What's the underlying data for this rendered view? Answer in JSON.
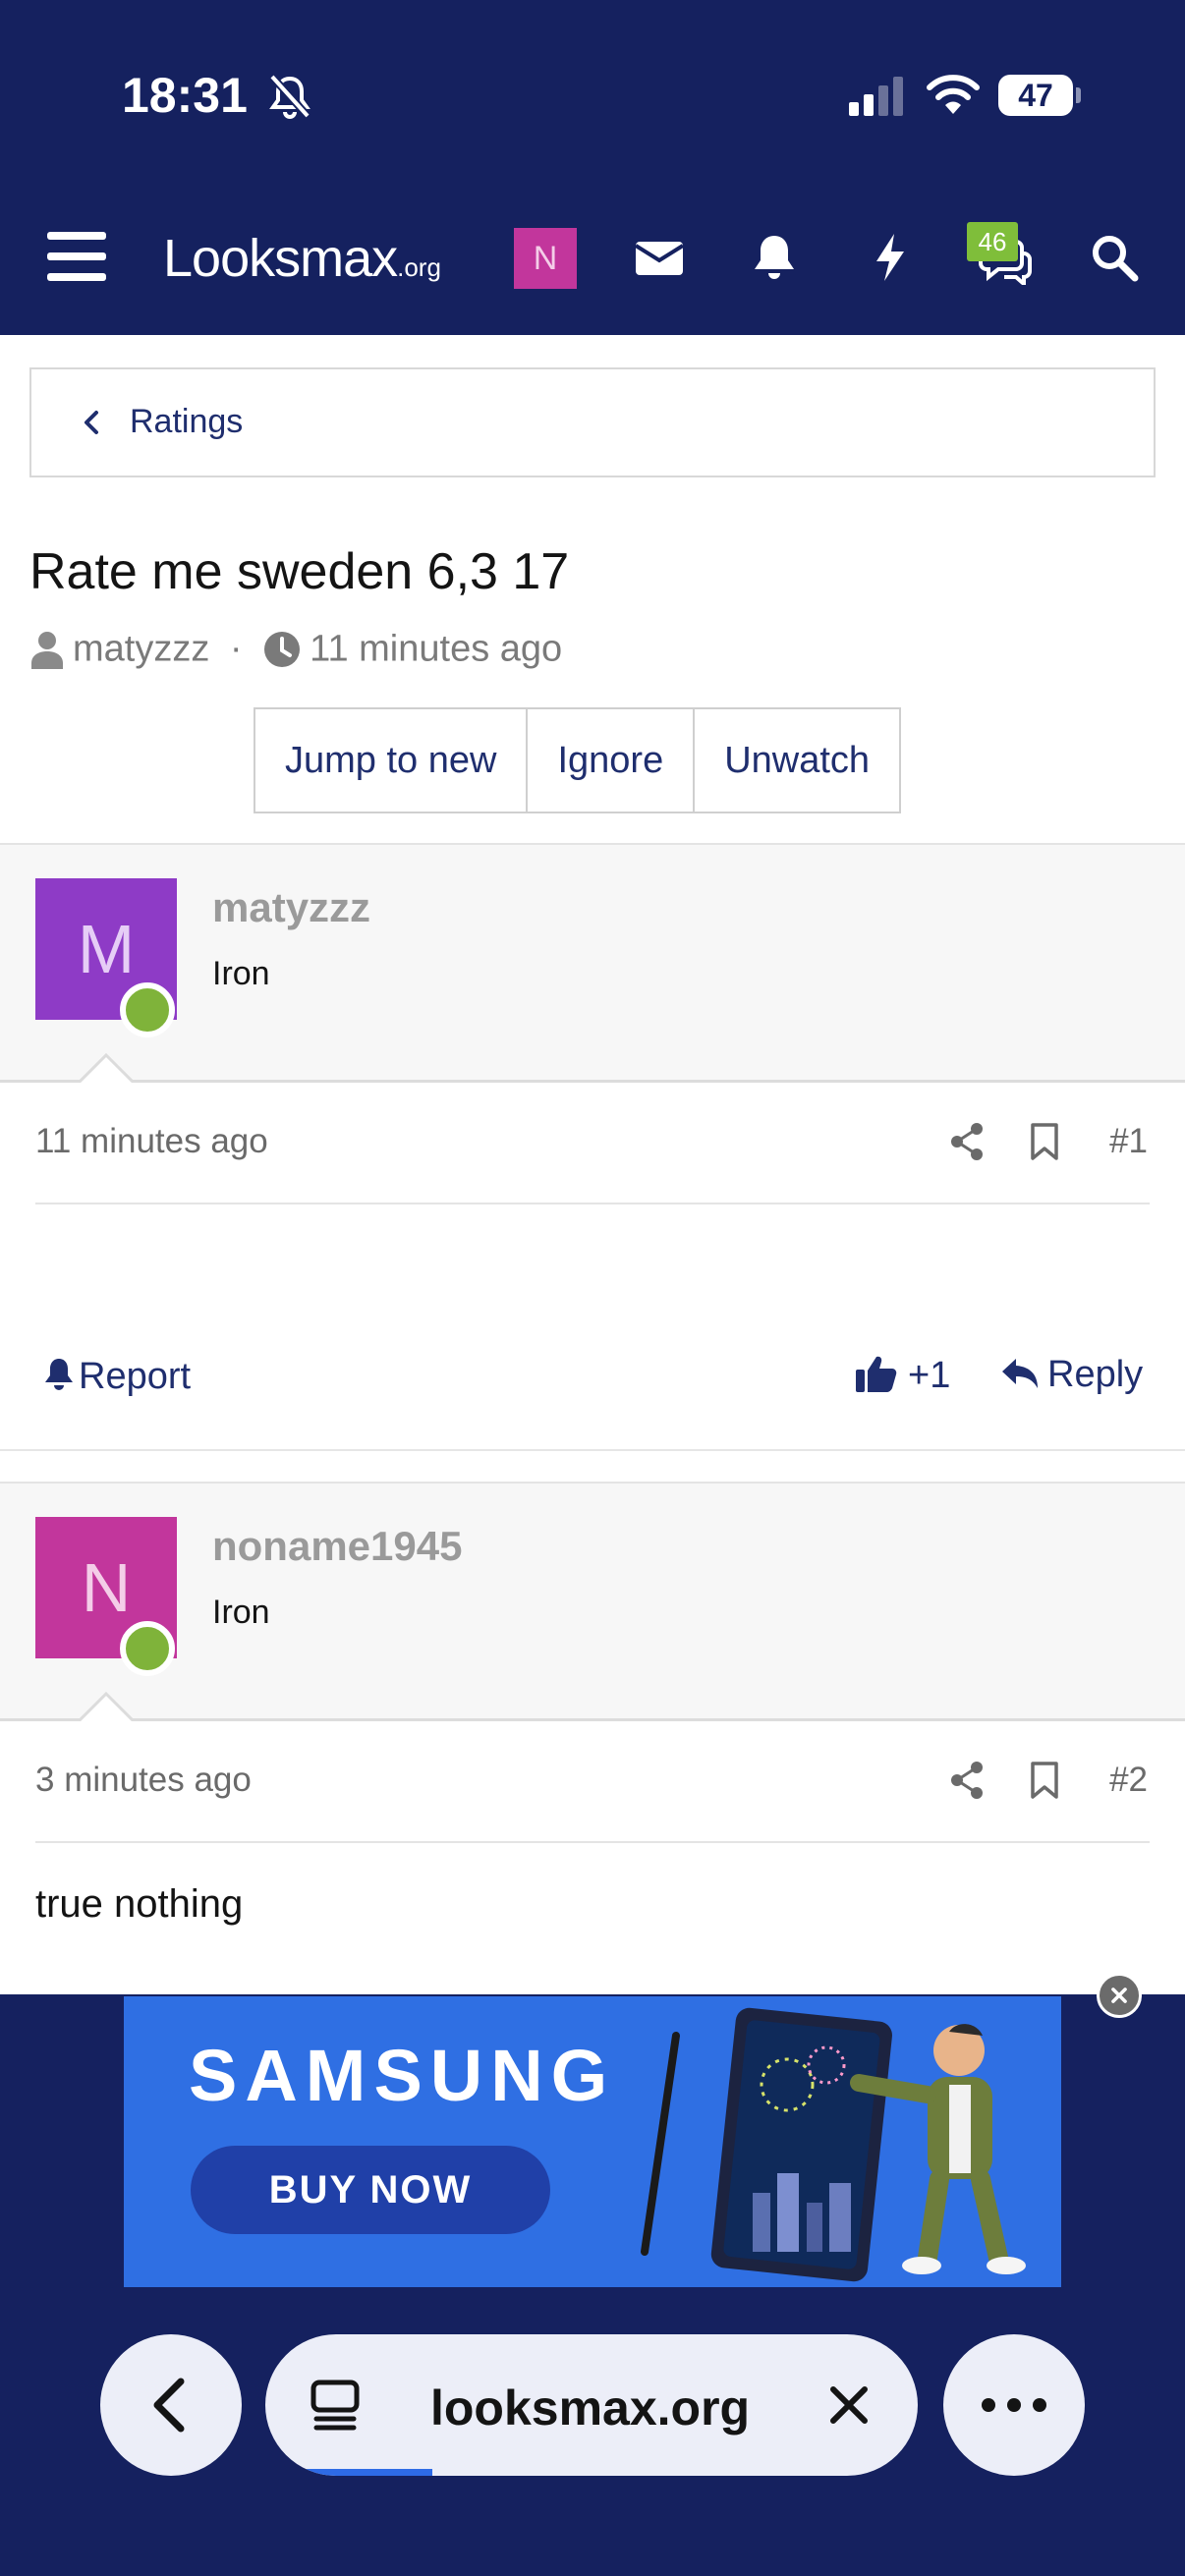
{
  "status_bar": {
    "time": "18:31",
    "battery": "47"
  },
  "header": {
    "logo_text": "Looksmax",
    "logo_suffix": ".org",
    "user_avatar_letter": "N",
    "conversations_badge": "46",
    "colors": {
      "header_bg": "#15215f",
      "badge": "#7fbe3a",
      "avatar_bg": "#c2369c"
    }
  },
  "breadcrumb": {
    "label": "Ratings"
  },
  "thread": {
    "title": "Rate me sweden 6,3 17",
    "author": "matyzzz",
    "separator": "·",
    "time": "11 minutes ago",
    "buttons": [
      "Jump to new",
      "Ignore",
      "Unwatch"
    ]
  },
  "posts": [
    {
      "avatar_letter": "M",
      "avatar_color": "#8e3bc6",
      "username": "matyzzz",
      "rank": "Iron",
      "time": "11 minutes ago",
      "number": "#1",
      "body": ""
    },
    {
      "avatar_letter": "N",
      "avatar_color": "#c2369c",
      "username": "noname1945",
      "rank": "Iron",
      "time": "3 minutes ago",
      "number": "#2",
      "body": "true nothing"
    }
  ],
  "post_actions": {
    "report": "Report",
    "like_count": "+1",
    "reply": "Reply"
  },
  "ad": {
    "brand": "SAMSUNG",
    "cta": "BUY NOW"
  },
  "browser": {
    "url": "looksmax.org"
  },
  "icons": [
    "bell-slash-icon",
    "signal-icon",
    "wifi-icon",
    "battery-icon",
    "hamburger-icon",
    "envelope-icon",
    "bell-icon",
    "bolt-icon",
    "chat-icon",
    "search-icon",
    "chevron-left-icon",
    "user-icon",
    "clock-icon",
    "share-icon",
    "bookmark-icon",
    "thumbs-up-icon",
    "reply-icon",
    "close-icon",
    "tabs-icon",
    "more-icon"
  ]
}
